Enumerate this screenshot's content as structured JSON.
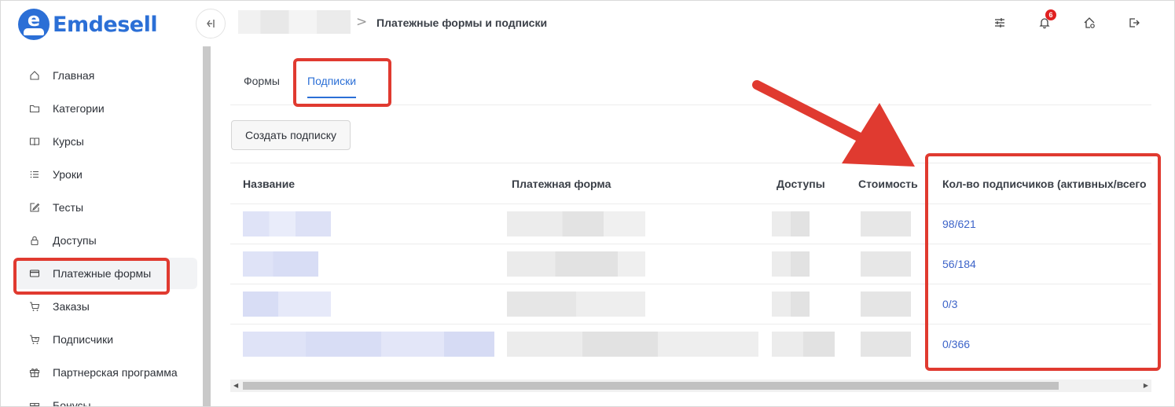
{
  "brand": {
    "name": "Emdesell",
    "logo_letter": "e",
    "color": "#2b6fd6"
  },
  "header": {
    "collapse_icon": "collapse-sidebar-icon",
    "breadcrumb_separator": ">",
    "title": "Платежные формы и подписки",
    "icons": [
      "settings-sliders-icon",
      "bell-icon",
      "home-settings-icon",
      "logout-icon"
    ],
    "notifications_count": "6"
  },
  "sidebar": {
    "items": [
      {
        "label": "Главная",
        "icon": "home-icon"
      },
      {
        "label": "Категории",
        "icon": "folder-icon"
      },
      {
        "label": "Курсы",
        "icon": "book-icon"
      },
      {
        "label": "Уроки",
        "icon": "list-icon"
      },
      {
        "label": "Тесты",
        "icon": "edit-icon"
      },
      {
        "label": "Доступы",
        "icon": "lock-icon"
      },
      {
        "label": "Платежные формы",
        "icon": "credit-card-icon",
        "active": true
      },
      {
        "label": "Заказы",
        "icon": "cart-icon"
      },
      {
        "label": "Подписчики",
        "icon": "cart-user-icon"
      },
      {
        "label": "Партнерская программа",
        "icon": "gift-icon"
      },
      {
        "label": "Бонусы",
        "icon": "gift-icon"
      }
    ]
  },
  "tabs": [
    {
      "label": "Формы",
      "active": false
    },
    {
      "label": "Подписки",
      "active": true
    }
  ],
  "create_button": "Создать подписку",
  "table": {
    "columns": [
      "Название",
      "Платежная форма",
      "Доступы",
      "Стоимость",
      "Кол-во подписчиков (активных/всего"
    ],
    "rows": [
      {
        "subscribers": "98/621"
      },
      {
        "subscribers": "56/184"
      },
      {
        "subscribers": "0/3"
      },
      {
        "subscribers": "0/366"
      }
    ]
  },
  "colors": {
    "accent": "#2b6fd6",
    "link": "#3d64c9",
    "annotation": "#e03a30",
    "badge": "#e02020"
  }
}
